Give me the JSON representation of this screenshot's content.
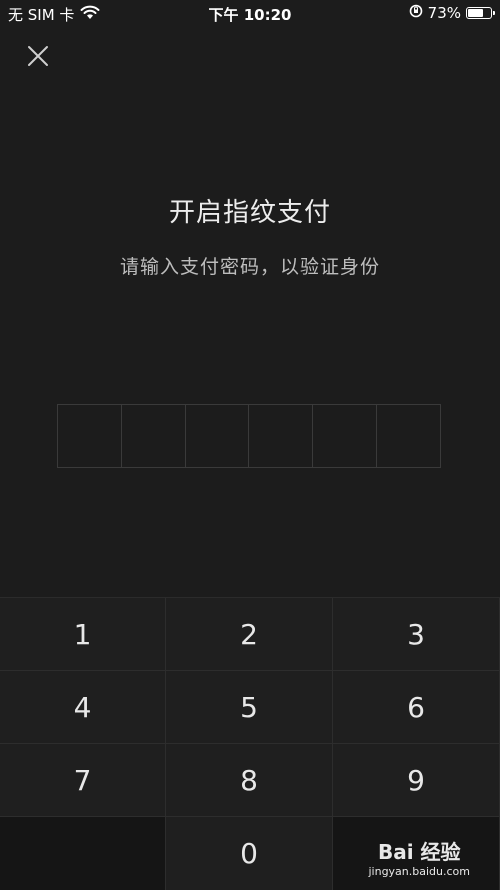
{
  "status_bar": {
    "carrier": "无 SIM 卡",
    "time": "下午 10:20",
    "battery_percent": "73%",
    "battery_level": 0.73
  },
  "header": {
    "close_icon": "close-icon"
  },
  "main": {
    "title": "开启指纹支付",
    "subtitle": "请输入支付密码，以验证身份",
    "pin_length": 6
  },
  "keypad": {
    "keys": [
      "1",
      "2",
      "3",
      "4",
      "5",
      "6",
      "7",
      "8",
      "9",
      "",
      "0",
      ""
    ]
  },
  "watermark": {
    "logo_text": "Bai 经验",
    "url": "jingyan.baidu.com"
  }
}
